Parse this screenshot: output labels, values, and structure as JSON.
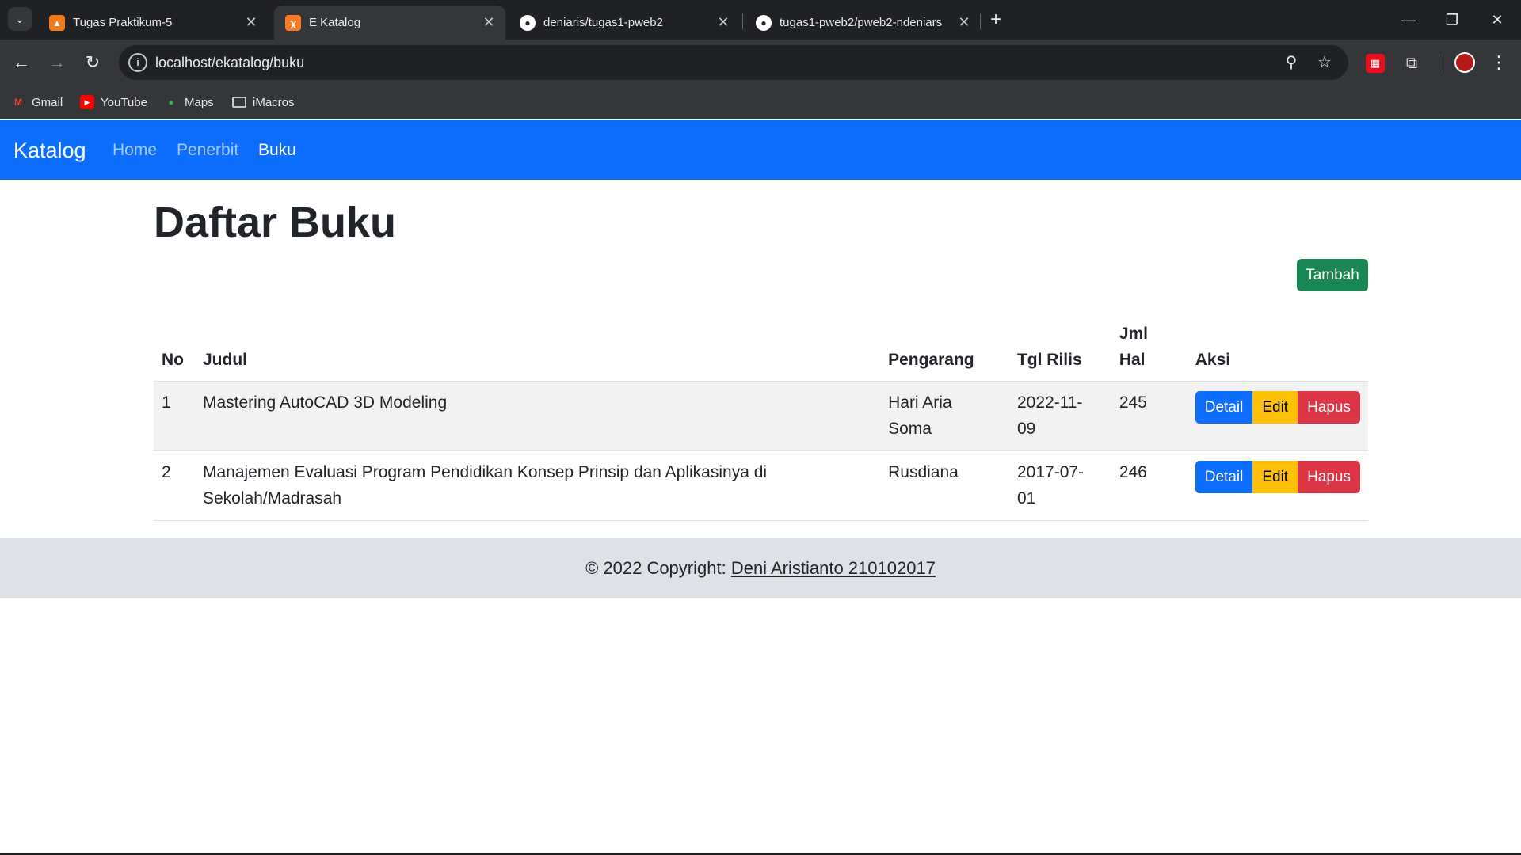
{
  "browser": {
    "tabs": [
      {
        "title": "Tugas Praktikum-5",
        "favicon_color": "#f07b18"
      },
      {
        "title": "E Katalog",
        "favicon_color": "#fb7a24"
      },
      {
        "title": "deniaris/tugas1-pweb2",
        "favicon_color": "#ffffff"
      },
      {
        "title": "tugas1-pweb2/pweb2-ndeniars",
        "favicon_color": "#ffffff"
      }
    ],
    "url": "localhost/ekatalog/buku",
    "bookmarks": [
      {
        "label": "Gmail"
      },
      {
        "label": "YouTube"
      },
      {
        "label": "Maps"
      },
      {
        "label": "iMacros"
      }
    ]
  },
  "navbar": {
    "brand": "Katalog",
    "links": [
      "Home",
      "Penerbit",
      "Buku"
    ],
    "color": "#0d6efd"
  },
  "main": {
    "title": "Daftar Buku",
    "add_button": "Tambah",
    "table": {
      "headers": {
        "no": "No",
        "judul": "Judul",
        "pengarang": "Pengarang",
        "tgl_rilis": "Tgl Rilis",
        "jml_hal_1": "Jml",
        "jml_hal_2": "Hal",
        "aksi": "Aksi"
      },
      "rows": [
        {
          "no": "1",
          "judul": "Mastering AutoCAD 3D Modeling",
          "pengarang_1": "Hari Aria",
          "pengarang_2": "Soma",
          "tgl_1": "2022-11-",
          "tgl_2": "09",
          "hal": "245"
        },
        {
          "no": "2",
          "judul_1": "Manajemen Evaluasi Program Pendidikan Konsep Prinsip dan Aplikasinya di",
          "judul_2": "Sekolah/Madrasah",
          "pengarang": "Rusdiana",
          "tgl_1": "2017-07-",
          "tgl_2": "01",
          "hal": "246"
        }
      ],
      "actions": {
        "detail": "Detail",
        "edit": "Edit",
        "hapus": "Hapus"
      }
    }
  },
  "footer": {
    "prefix": "© 2022 Copyright: ",
    "link": "Deni Aristianto 210102017"
  }
}
